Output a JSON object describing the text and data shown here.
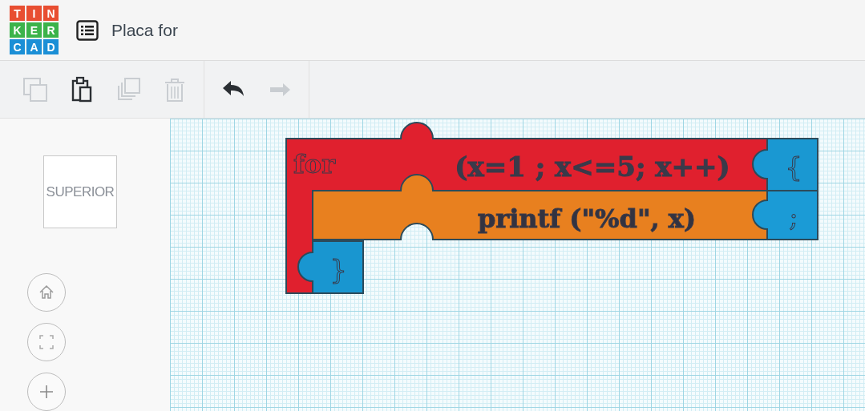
{
  "logo": {
    "rows": [
      [
        "T",
        "I",
        "N"
      ],
      [
        "K",
        "E",
        "R"
      ],
      [
        "C",
        "A",
        "D"
      ]
    ]
  },
  "header": {
    "title": "Placa for"
  },
  "toolbar": [
    {
      "kind": "copy",
      "disabled": true
    },
    {
      "kind": "paste",
      "disabled": false
    },
    {
      "kind": "duplicate",
      "disabled": true
    },
    {
      "kind": "delete",
      "disabled": true
    },
    {
      "kind": "undo",
      "disabled": false
    },
    {
      "kind": "redo",
      "disabled": true
    }
  ],
  "view_cube": {
    "label": "SUPERIOR"
  },
  "view_controls": [
    {
      "kind": "home"
    },
    {
      "kind": "fit"
    },
    {
      "kind": "zoom-in"
    }
  ],
  "blocks": [
    {
      "kind": "loop",
      "color": "#e0202e",
      "keyword": "for",
      "text": "(x=1 ; x<=5; x++)"
    },
    {
      "kind": "statement",
      "color": "#e8801f",
      "text": "printf (\"%d\", x)"
    },
    {
      "kind": "cap-open",
      "color": "#1a98d2",
      "text": "{"
    },
    {
      "kind": "cap-semicolon",
      "color": "#1b9bd6",
      "text": ";"
    },
    {
      "kind": "cap-close",
      "color": "#1996d0",
      "text": "}"
    }
  ]
}
